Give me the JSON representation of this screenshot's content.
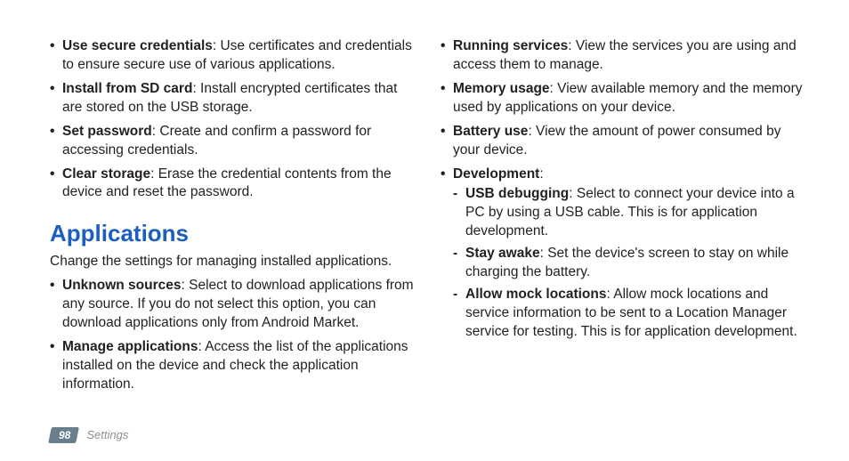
{
  "leftTop": [
    {
      "term": "Use secure credentials",
      "desc": ": Use certificates and credentials to ensure secure use of various applications."
    },
    {
      "term": "Install from SD card",
      "desc": ": Install encrypted certificates that are stored on the USB storage."
    },
    {
      "term": "Set password",
      "desc": ": Create and confirm a password for accessing credentials."
    },
    {
      "term": "Clear storage",
      "desc": ": Erase the credential contents from the device and reset the password."
    }
  ],
  "section": {
    "title": "Applications",
    "intro": "Change the settings for managing installed applications."
  },
  "leftBottom": [
    {
      "term": "Unknown sources",
      "desc": ": Select to download applications from any source. If you do not select this option, you can download applications only from Android Market."
    },
    {
      "term": "Manage applications",
      "desc": ": Access the list of the applications installed on the device and check the application information."
    }
  ],
  "right": [
    {
      "term": "Running services",
      "desc": ": View the services you are using and access them to manage."
    },
    {
      "term": "Memory usage",
      "desc": ": View available memory and the memory used by applications on your device."
    },
    {
      "term": "Battery use",
      "desc": ": View the amount of power consumed by your device."
    },
    {
      "term": "Development",
      "desc": ":",
      "sub": [
        {
          "term": "USB debugging",
          "desc": ": Select to connect your device into a PC by using a USB cable. This is for application development."
        },
        {
          "term": "Stay awake",
          "desc": ": Set the device's screen to stay on while charging the battery."
        },
        {
          "term": "Allow mock locations",
          "desc": ": Allow mock locations and service information to be sent to a Location Manager service for testing. This is for application development."
        }
      ]
    }
  ],
  "footer": {
    "page": "98",
    "label": "Settings"
  }
}
